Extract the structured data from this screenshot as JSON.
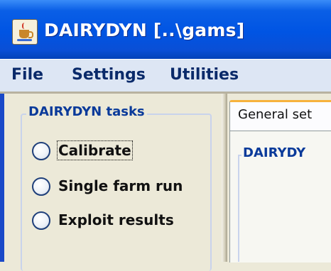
{
  "window": {
    "title": "DAIRYDYN [..\\gams]",
    "icon": "java-cup-icon"
  },
  "menu": {
    "items": [
      "File",
      "Settings",
      "Utilities"
    ]
  },
  "tasks": {
    "group_title": "DAIRYDYN tasks",
    "options": [
      {
        "label": "Calibrate",
        "selected": false,
        "focused": true
      },
      {
        "label": "Single farm run",
        "selected": false,
        "focused": false
      },
      {
        "label": "Exploit results",
        "selected": false,
        "focused": false
      }
    ]
  },
  "right_panel": {
    "tab_label": "General set",
    "group_title": "DAIRYDY"
  },
  "colors": {
    "titlebar": "#0054e3",
    "group_title_text": "#0a3a9a",
    "tab_highlight": "#f7b23c"
  }
}
